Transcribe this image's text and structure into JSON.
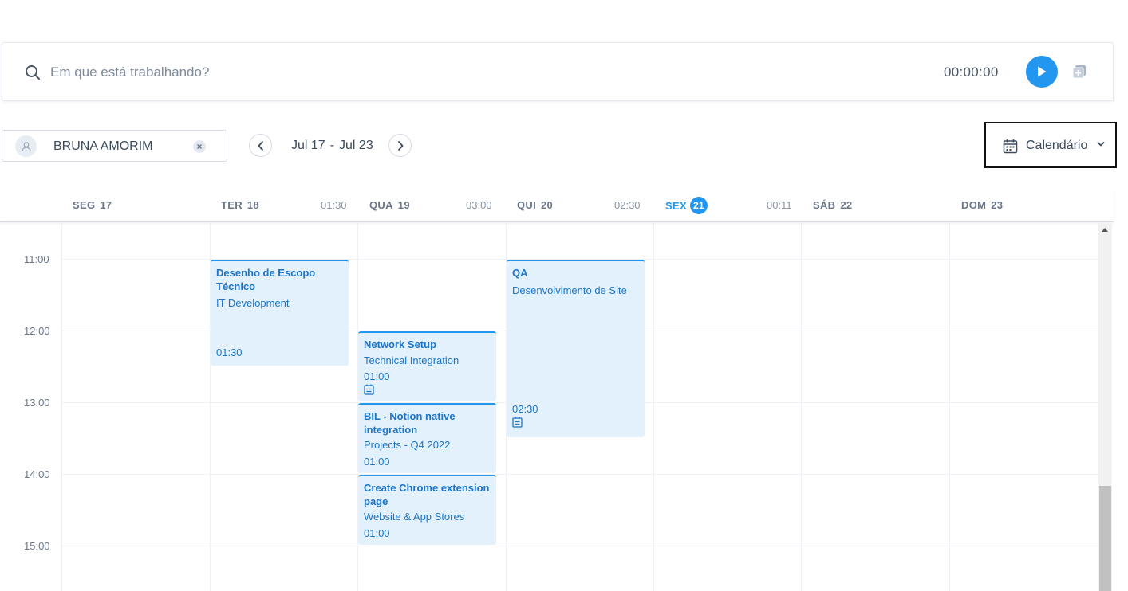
{
  "timer": {
    "placeholder": "Em que está trabalhando?",
    "duration": "00:00:00",
    "accent_color": "#2396f0"
  },
  "member": {
    "name": "BRUNA AMORIM"
  },
  "date_range": {
    "start": "Jul 17",
    "separator": "-",
    "end": "Jul 23"
  },
  "view": {
    "label": "Calendário"
  },
  "days": [
    {
      "name": "SEG",
      "num": "17",
      "total": ""
    },
    {
      "name": "TER",
      "num": "18",
      "total": "01:30"
    },
    {
      "name": "QUA",
      "num": "19",
      "total": "03:00"
    },
    {
      "name": "QUI",
      "num": "20",
      "total": "02:30"
    },
    {
      "name": "SEX",
      "num": "21",
      "total": "00:11",
      "today": true
    },
    {
      "name": "SÁB",
      "num": "22",
      "total": ""
    },
    {
      "name": "DOM",
      "num": "23",
      "total": ""
    }
  ],
  "hours": [
    "11:00",
    "12:00",
    "13:00",
    "14:00",
    "15:00"
  ],
  "events": [
    {
      "title": "Desenho de Escopo Técnico",
      "project": "IT Development",
      "duration": "01:30"
    },
    {
      "title": "Network Setup",
      "project": "Technical Integration",
      "duration": "01:00"
    },
    {
      "title": "BIL - Notion native integration",
      "project": "Projects - Q4 2022",
      "duration": "01:00"
    },
    {
      "title": "Create Chrome extension page",
      "project": "Website & App Stores",
      "duration": "01:00"
    },
    {
      "title": "QA",
      "project": "Desenvolvimento de Site",
      "duration": "02:30"
    }
  ]
}
